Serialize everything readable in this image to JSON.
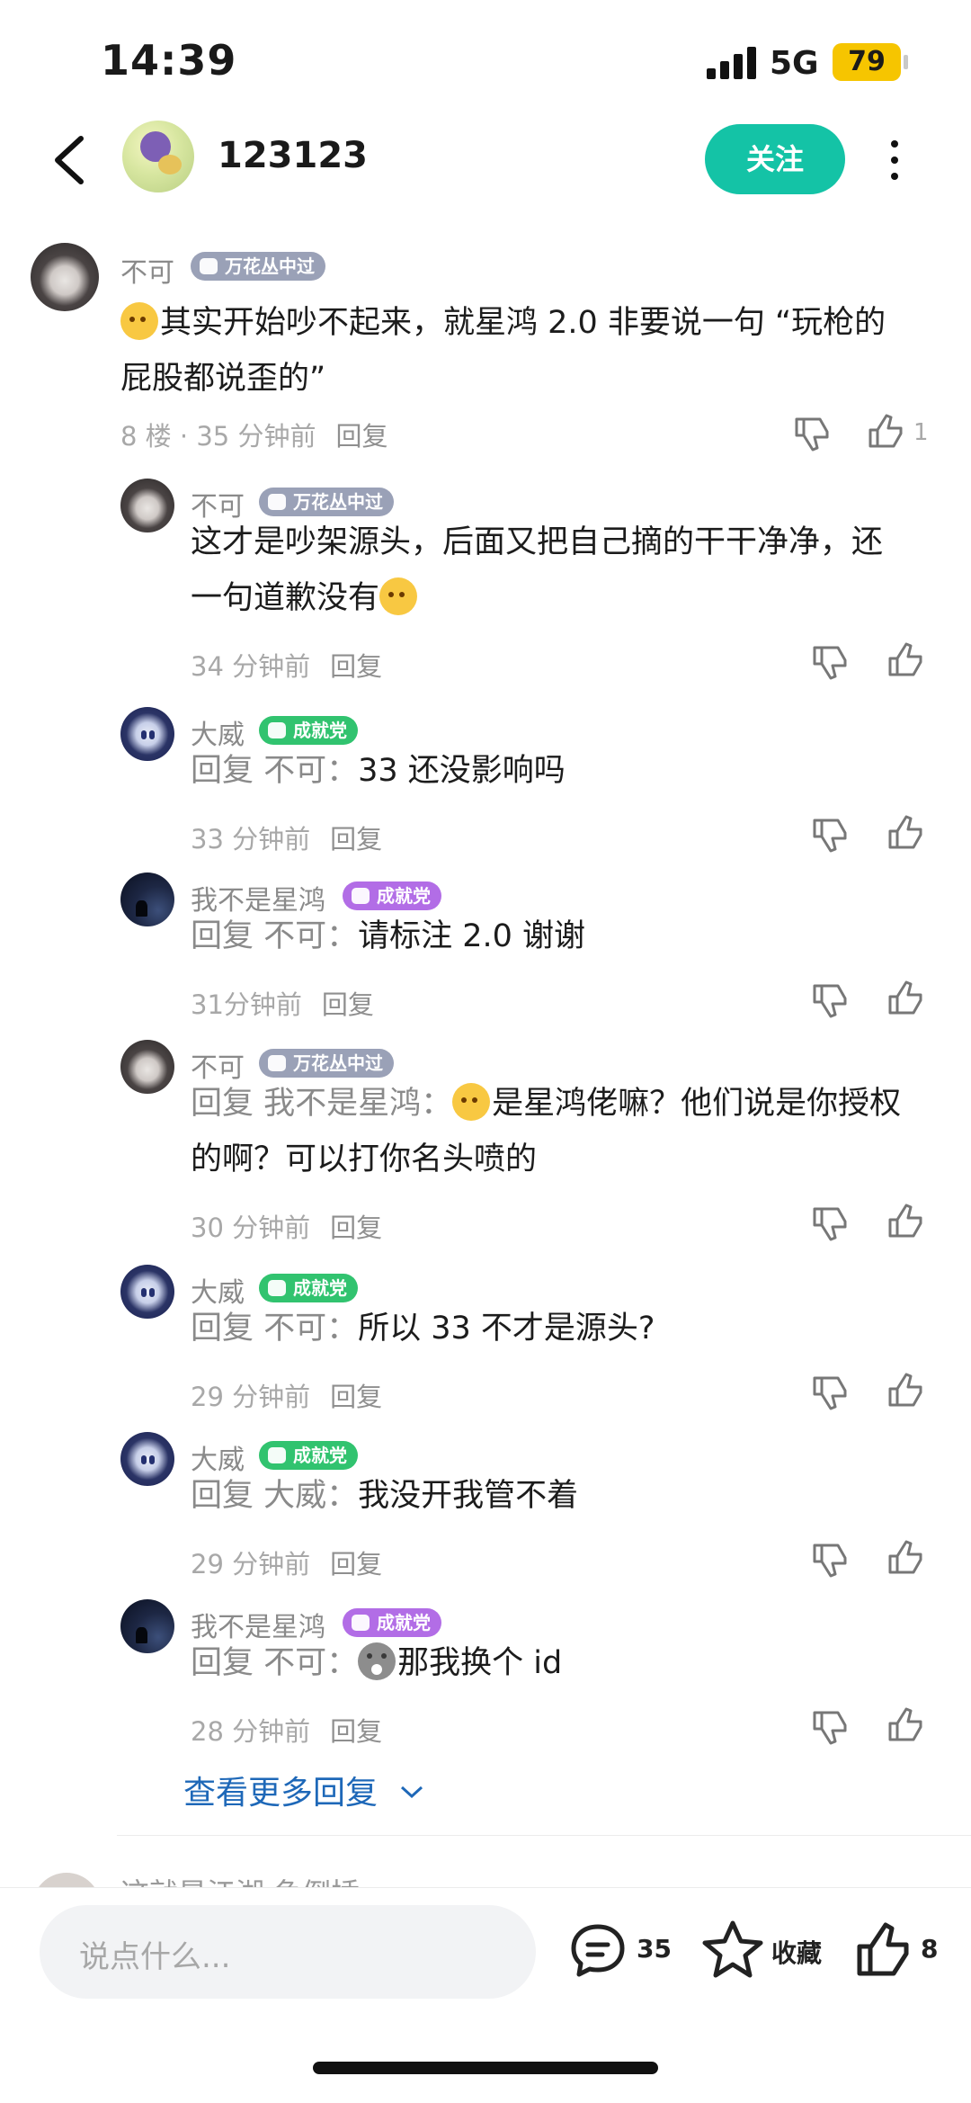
{
  "status_bar": {
    "time": "14:39",
    "network": "5G",
    "battery": "79"
  },
  "header": {
    "title": "123123",
    "follow_label": "关注"
  },
  "main_comment": {
    "user": "不可",
    "badge": "万花丛中过",
    "text": "其实开始吵不起来，就星鸿 2.0 非要说一句 “玩枪的屁股都说歪的”",
    "floor": "8 楼 · 35 分钟前",
    "reply_label": "回复",
    "like_count": "1"
  },
  "replies": [
    {
      "user": "不可",
      "badge": "万花丛中过",
      "badge_color": "#9aa1b7",
      "prefix": "",
      "text": "这才是吵架源头，后面又把自己摘的干干净净，还一句道歉没有",
      "emoji": "smile-emoji",
      "time": "34 分钟前",
      "reply_label": "回复"
    },
    {
      "user": "大威",
      "badge": "成就党",
      "badge_color": "#31c36f",
      "prefix": "回复  不可：",
      "text": "33 还没影响吗",
      "time": "33 分钟前",
      "reply_label": "回复"
    },
    {
      "user": "我不是星鸿",
      "badge": "成就党",
      "badge_color": "#b26de6",
      "prefix": "回复  不可：",
      "text": "请标注 2.0 谢谢",
      "time": "31分钟前",
      "reply_label": "回复"
    },
    {
      "user": "不可",
      "badge": "万花丛中过",
      "badge_color": "#9aa1b7",
      "prefix": "回复  我不是星鸿：",
      "text": "是星鸿佬嘛？他们说是你授权的啊？可以打你名头喷的",
      "emoji": "smile-emoji",
      "time": "30 分钟前",
      "reply_label": "回复"
    },
    {
      "user": "大威",
      "badge": "成就党",
      "badge_color": "#31c36f",
      "prefix": "回复  不可：",
      "text": "所以 33 不才是源头?",
      "time": "29 分钟前",
      "reply_label": "回复"
    },
    {
      "user": "大威",
      "badge": "成就党",
      "badge_color": "#31c36f",
      "prefix": "回复  大威：",
      "text": "我没开我管不着",
      "time": "29 分钟前",
      "reply_label": "回复"
    },
    {
      "user": "我不是星鸿",
      "badge": "成就党",
      "badge_color": "#b26de6",
      "prefix": "回复  不可：",
      "text": "那我换个 id",
      "emoji": "shocked-emoji",
      "time": "28 分钟前",
      "reply_label": "回复"
    }
  ],
  "see_more": "查看更多回复",
  "next_comment_peek": "这就是江湖  鱼倒插",
  "bottom_bar": {
    "input_placeholder": "说点什么...",
    "comment_count": "35",
    "favorite_label": "收藏",
    "like_count": "8"
  }
}
